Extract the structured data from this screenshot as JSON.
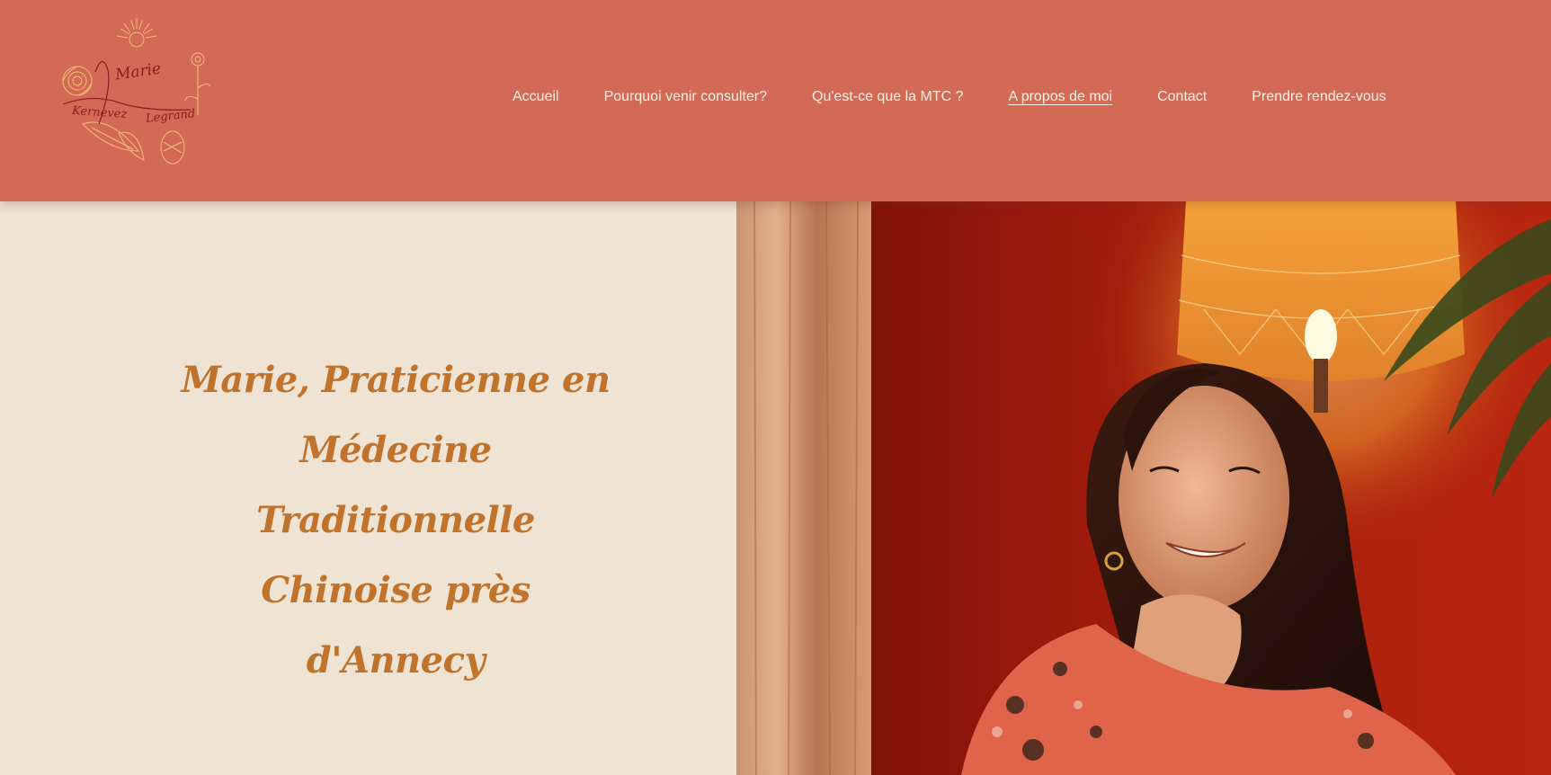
{
  "brand": {
    "first_name": "Marie",
    "last_name_1": "Kernevez",
    "last_name_2": "Legrand"
  },
  "nav": {
    "items": [
      {
        "label": "Accueil",
        "active": false
      },
      {
        "label": "Pourquoi venir consulter?",
        "active": false
      },
      {
        "label": "Qu'est-ce que la MTC ?",
        "active": false
      },
      {
        "label": "A propos de moi",
        "active": true
      },
      {
        "label": "Contact",
        "active": false
      },
      {
        "label": "Prendre rendez-vous",
        "active": false
      }
    ]
  },
  "hero": {
    "title_line_1": "Marie, Praticienne en",
    "title_line_2": "Médecine Traditionnelle",
    "title_line_3": "Chinoise près d'Annecy"
  },
  "colors": {
    "header_bg": "#d36a55",
    "page_bg": "#efe3d3",
    "title_color": "#c1732c",
    "nav_text": "#fbf1e6",
    "logo_text": "#8a1e22",
    "logo_line": "#f0c074"
  }
}
